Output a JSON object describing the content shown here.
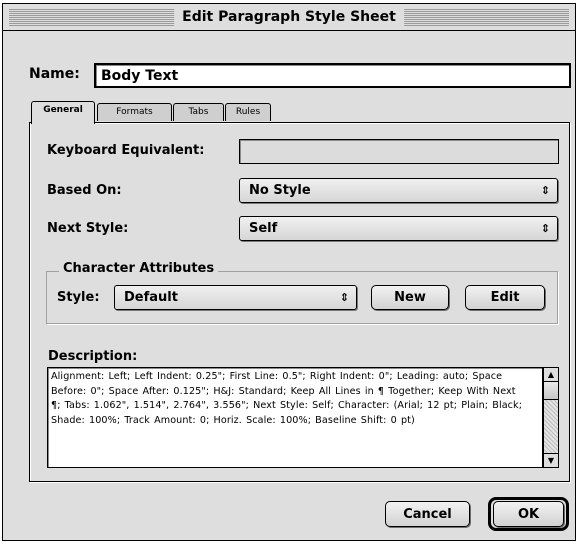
{
  "dialog": {
    "title": "Edit Paragraph Style Sheet"
  },
  "name": {
    "label": "Name:",
    "value": "Body Text"
  },
  "tabs": [
    {
      "label": "General",
      "active": true
    },
    {
      "label": "Formats",
      "active": false
    },
    {
      "label": "Tabs",
      "active": false
    },
    {
      "label": "Rules",
      "active": false
    }
  ],
  "general": {
    "keyboard_label": "Keyboard Equivalent:",
    "keyboard_value": "",
    "based_on_label": "Based On:",
    "based_on_value": "No Style",
    "next_style_label": "Next Style:",
    "next_style_value": "Self",
    "popup_arrows": "⇕",
    "character_attributes": {
      "title": "Character Attributes",
      "style_label": "Style:",
      "style_value": "Default",
      "new_label": "New",
      "edit_label": "Edit"
    },
    "description_label": "Description:",
    "description_text": "Alignment: Left;  Left Indent: 0.25\";  First Line: 0.5\";  Right Indent: 0\"; Leading: auto;  Space Before: 0\";  Space After: 0.125\";  H&J: Standard; Keep All Lines in ¶ Together;  Keep With Next ¶;  Tabs: 1.062\", 1.514\", 2.764\", 3.556\";  Next Style: Self;  Character: (Arial;  12 pt;  Plain; Black;  Shade: 100%;  Track Amount: 0;  Horiz. Scale: 100%;  Baseline Shift: 0 pt)"
  },
  "footer": {
    "cancel_label": "Cancel",
    "ok_label": "OK"
  }
}
